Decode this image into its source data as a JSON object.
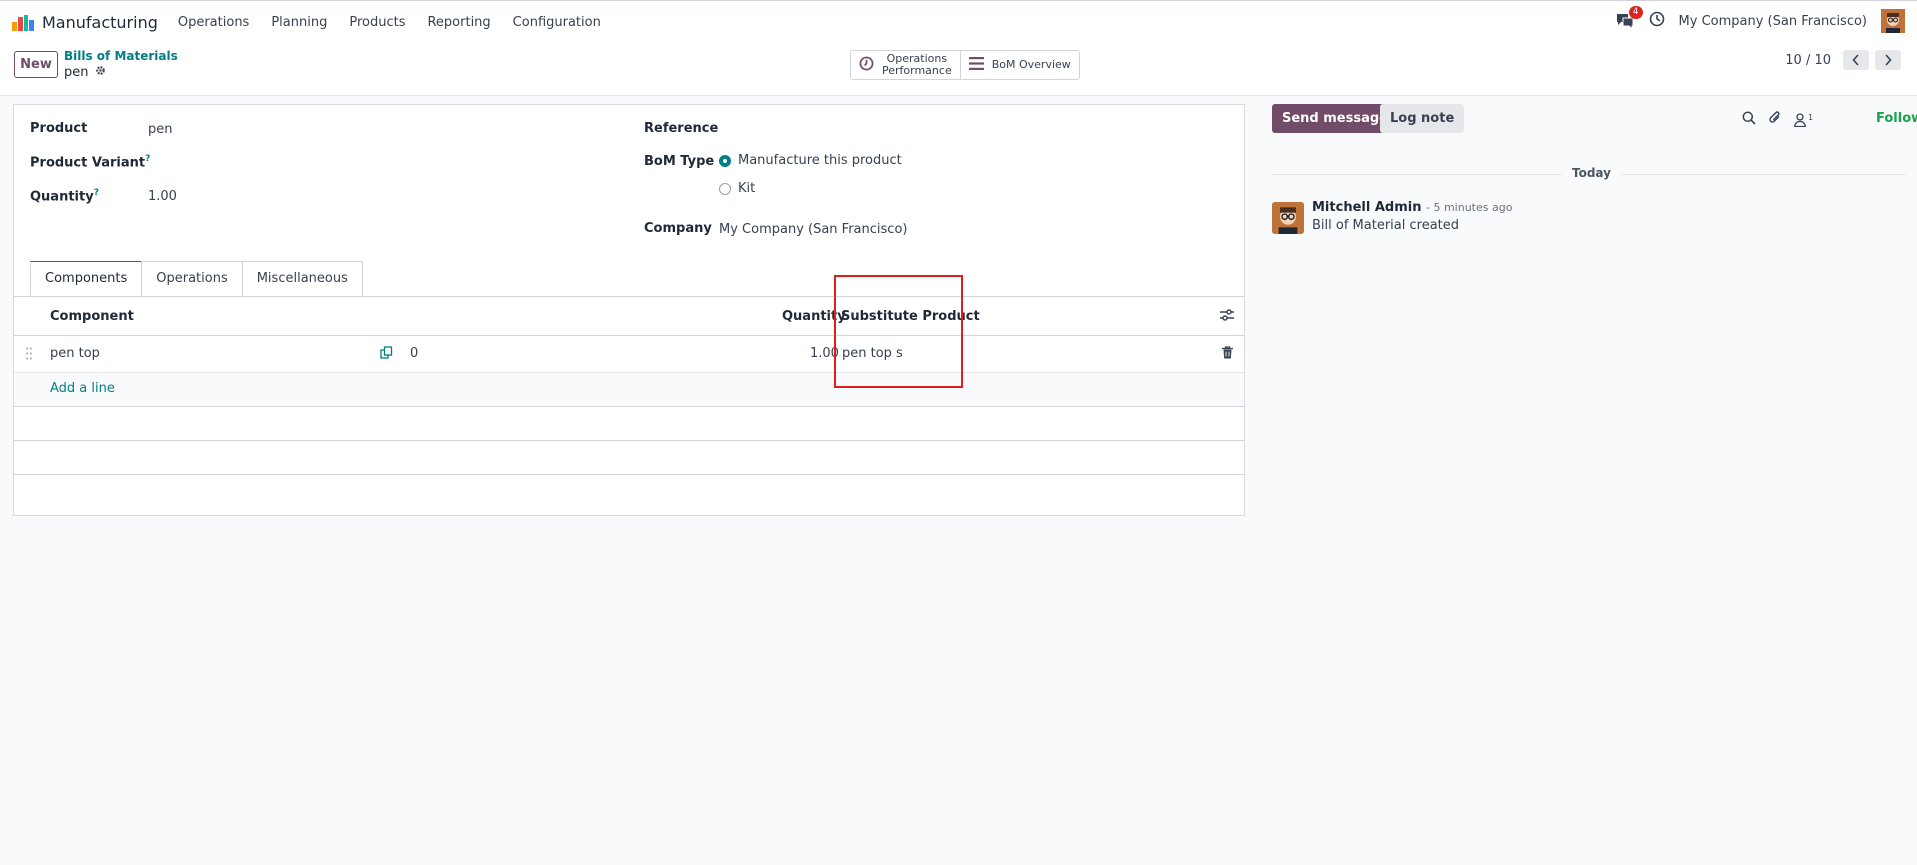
{
  "topbar": {
    "app_name": "Manufacturing",
    "menu": [
      "Operations",
      "Planning",
      "Products",
      "Reporting",
      "Configuration"
    ],
    "notification_count": "4",
    "company": "My Company (San Francisco)"
  },
  "controlbar": {
    "new_label": "New",
    "breadcrumb": "Bills of Materials",
    "record_name": "pen",
    "smart_buttons": {
      "operations_perf_line1": "Operations",
      "operations_perf_line2": "Performance",
      "bom_overview": "BoM Overview"
    },
    "pager": "10 / 10"
  },
  "form": {
    "product_label": "Product",
    "product_value": "pen",
    "variant_label": "Product Variant",
    "quantity_label": "Quantity",
    "quantity_value": "1.00",
    "help_mark": "?",
    "reference_label": "Reference",
    "bom_type_label": "BoM Type",
    "bom_type_options": [
      "Manufacture this product",
      "Kit"
    ],
    "company_label": "Company",
    "company_value": "My Company (San Francisco)"
  },
  "tabs": [
    "Components",
    "Operations",
    "Miscellaneous"
  ],
  "components_table": {
    "headers": {
      "component": "Component",
      "quantity": "Quantity",
      "substitute": "Substitute Product"
    },
    "rows": [
      {
        "component": "pen top",
        "count": "0",
        "quantity": "1.00",
        "substitute": "pen top s"
      }
    ],
    "add_line": "Add a line"
  },
  "chatter": {
    "send_message": "Send message",
    "log_note": "Log note",
    "followers_count": "1",
    "following": "Following",
    "today": "Today",
    "message": {
      "author": "Mitchell Admin",
      "time": "- 5 minutes ago",
      "body": "Bill of Material created"
    }
  }
}
